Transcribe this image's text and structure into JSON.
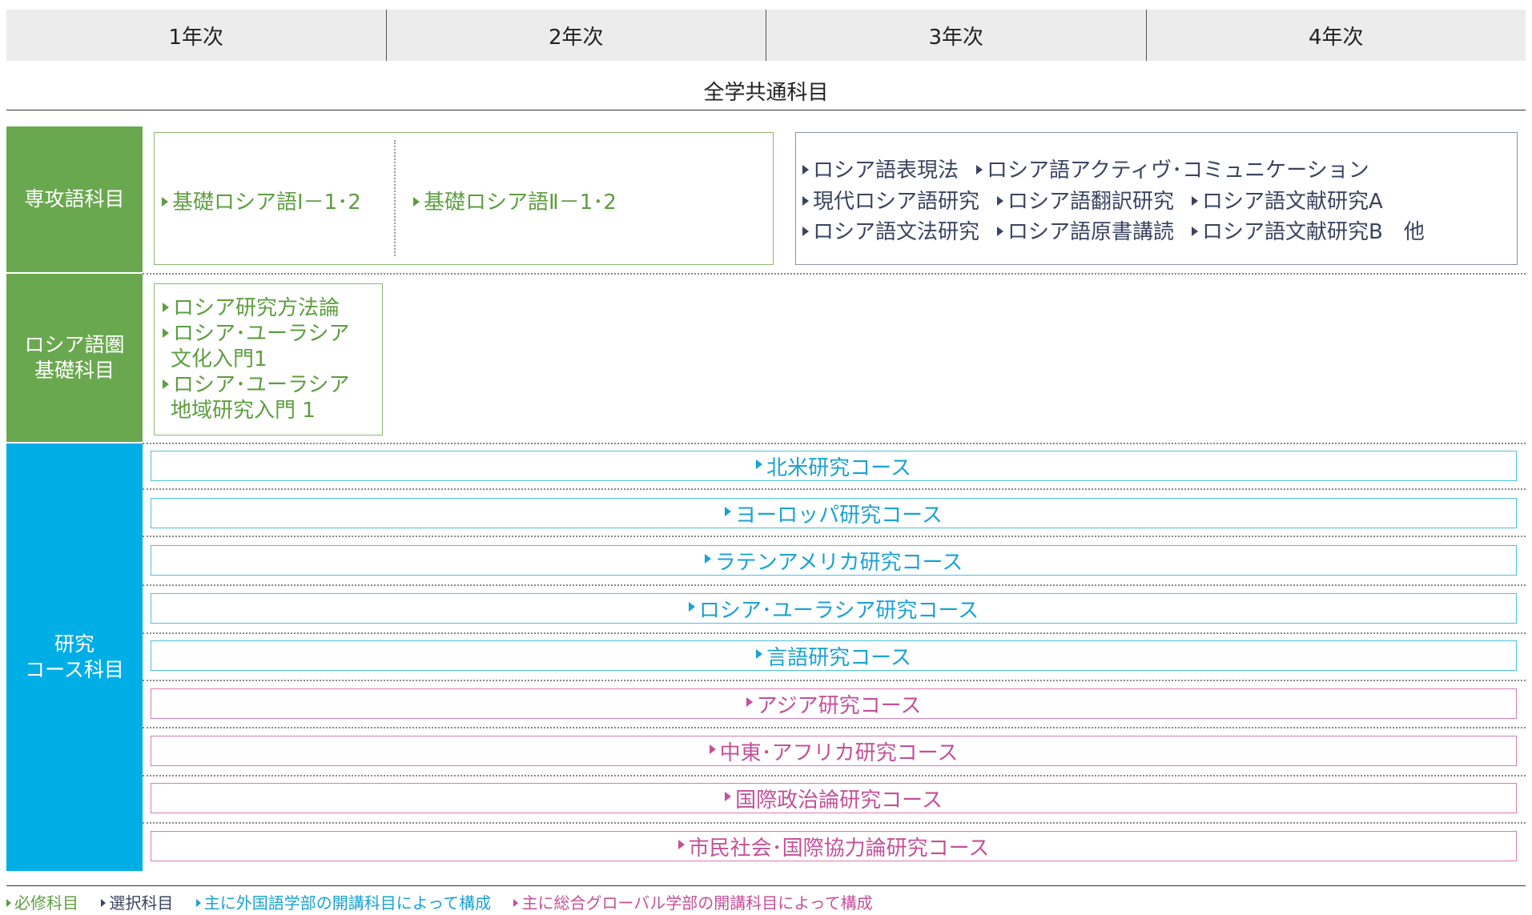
{
  "years": [
    "1年次",
    "2年次",
    "3年次",
    "4年次"
  ],
  "common_subjects": "全学共通科目",
  "categories": {
    "major_language": "専攻語科目",
    "russian_area_basic_line1": "ロシア語圏",
    "russian_area_basic_line2": "基礎科目",
    "research_course_line1": "研究",
    "research_course_line2": "コース科目"
  },
  "required_basic": [
    "基礎ロシア語Ⅰ－1･2",
    "基礎ロシア語Ⅱ－1･2"
  ],
  "elective_rows": [
    [
      "ロシア語表現法",
      "ロシア語アクティヴ･コミュニケーション"
    ],
    [
      "現代ロシア語研究",
      "ロシア語翻訳研究",
      "ロシア語文献研究A"
    ],
    [
      "ロシア語文法研究",
      "ロシア語原書講読",
      "ロシア語文献研究B　他"
    ]
  ],
  "area_basic": [
    {
      "line1": "ロシア研究方法論",
      "line2": ""
    },
    {
      "line1": "ロシア･ユーラシア",
      "line2": "文化入門1"
    },
    {
      "line1": "ロシア･ユーラシア",
      "line2": "地域研究入門 1"
    }
  ],
  "courses_foreign_studies": [
    "北米研究コース",
    "ヨーロッパ研究コース",
    "ラテンアメリカ研究コース",
    "ロシア･ユーラシア研究コース",
    "言語研究コース"
  ],
  "courses_global_studies": [
    "アジア研究コース",
    "中東･アフリカ研究コース",
    "国際政治論研究コース",
    "市民社会･国際協力論研究コース"
  ],
  "legend": {
    "required": "必修科目",
    "elective": "選択科目",
    "foreign_studies": "主に外国語学部の開講科目によって構成",
    "global_studies": "主に総合グローバル学部の開講科目によって構成"
  },
  "colors": {
    "green": "#6aa84f",
    "blue": "#00aee6",
    "pink": "#c4509a",
    "gray_text": "#3a4460"
  }
}
